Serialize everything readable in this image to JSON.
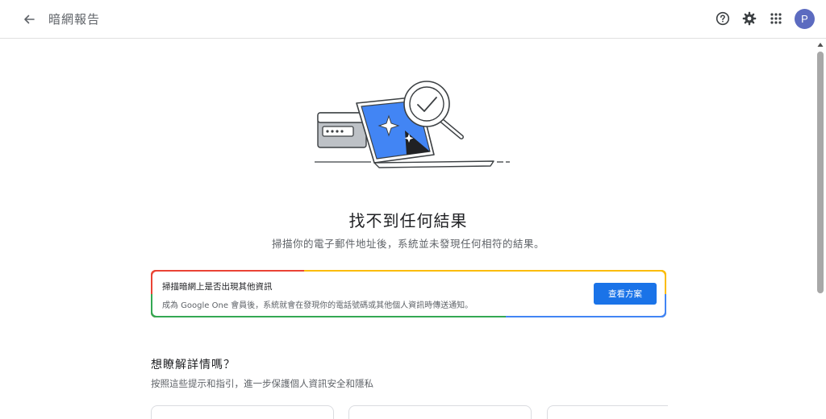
{
  "header": {
    "title": "暗網報告",
    "back_icon": "arrow-back-icon",
    "help_icon": "help-circle-icon",
    "settings_icon": "gear-icon",
    "apps_icon": "apps-grid-icon",
    "avatar_letter": "P"
  },
  "hero": {
    "illustration": "laptop-magnifier-check-illustration"
  },
  "result": {
    "title": "找不到任何結果",
    "subtitle": "掃描你的電子郵件地址後，系統並未發現任何相符的結果。"
  },
  "promo": {
    "title": "掃描暗網上是否出現其他資訊",
    "description": "成為 Google One 會員後，系統就會在發現你的電話號碼或其他個人資訊時傳送通知。",
    "button_label": "查看方案"
  },
  "learn_more": {
    "title": "想瞭解詳情嗎？",
    "subtitle": "按照這些提示和指引，進一步保護個人資訊安全和隱私"
  },
  "colors": {
    "accent": "#1a73e8",
    "avatar": "#5c6bc0",
    "google_red": "#ea4335",
    "google_yellow": "#fbbc04",
    "google_green": "#34a853",
    "google_blue": "#4285f4"
  }
}
